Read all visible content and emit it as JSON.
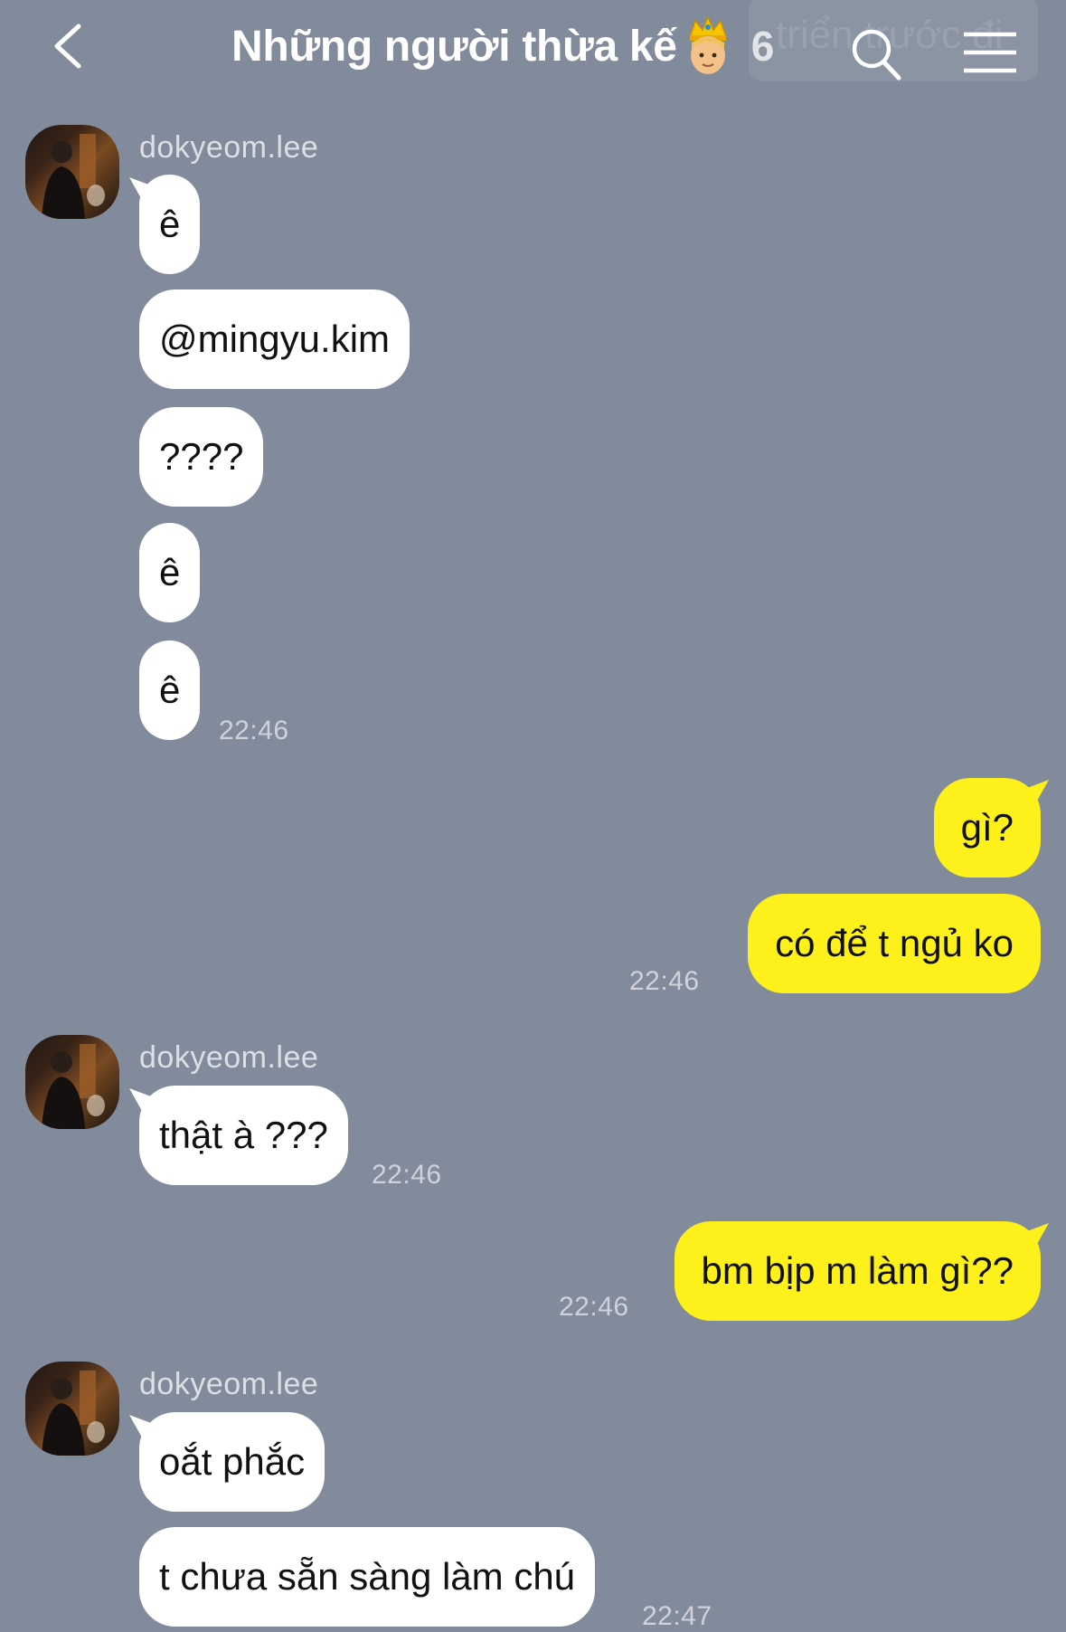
{
  "header": {
    "back_icon": "chevron-left-icon",
    "title": "Những người thừa kế",
    "title_emoji": "crown-person-emoji",
    "member_count": "6",
    "ghost_text": "triển trước đi",
    "search_icon": "search-icon",
    "menu_icon": "hamburger-menu-icon"
  },
  "colors": {
    "background": "#818b9b",
    "incoming_bubble": "#ffffff",
    "outgoing_bubble": "#fef01b"
  },
  "messages": [
    {
      "group": "in",
      "sender": "dokyeom.lee",
      "lines": [
        "ê",
        "@mingyu.kim",
        "????",
        "ê",
        "ê"
      ],
      "time": "22:46"
    },
    {
      "group": "out",
      "lines": [
        "gì?",
        "có để t ngủ ko"
      ],
      "time": "22:46"
    },
    {
      "group": "in",
      "sender": "dokyeom.lee",
      "lines": [
        "thật à ???"
      ],
      "time": "22:46"
    },
    {
      "group": "out",
      "lines": [
        "bm bịp m làm gì??"
      ],
      "time": "22:46"
    },
    {
      "group": "in",
      "sender": "dokyeom.lee",
      "lines": [
        "oắt phắc",
        "t chưa sẵn sàng làm chú"
      ],
      "time": "22:47"
    }
  ]
}
